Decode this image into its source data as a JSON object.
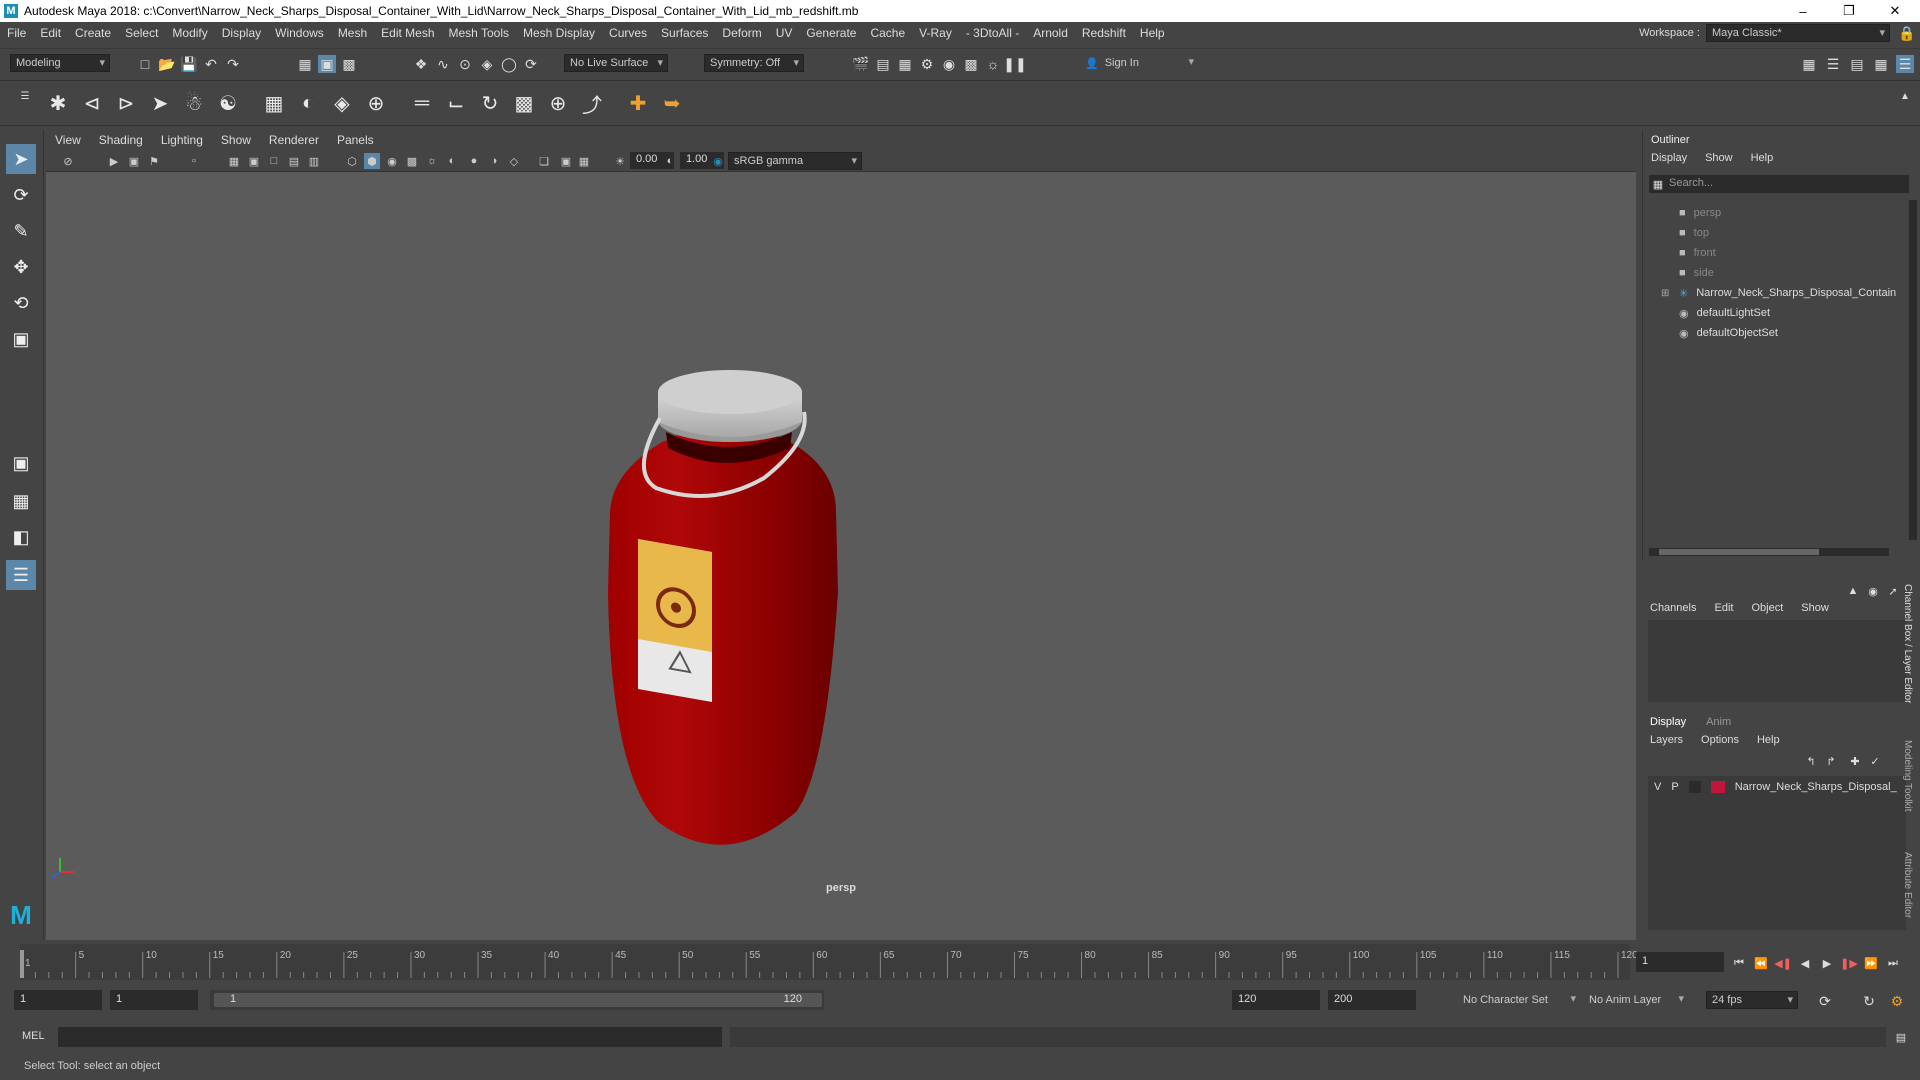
{
  "window": {
    "title": "Autodesk Maya 2018: c:\\Convert\\Narrow_Neck_Sharps_Disposal_Container_With_Lid\\Narrow_Neck_Sharps_Disposal_Container_With_Lid_mb_redshift.mb",
    "logo_letter": "M",
    "minimize": "–",
    "restore": "❐",
    "close": "✕"
  },
  "menubar": {
    "items": [
      "File",
      "Edit",
      "Create",
      "Select",
      "Modify",
      "Display",
      "Windows",
      "Mesh",
      "Edit Mesh",
      "Mesh Tools",
      "Mesh Display",
      "Curves",
      "Surfaces",
      "Deform",
      "UV",
      "Generate",
      "Cache",
      "V-Ray",
      "- 3DtoAll -",
      "Arnold",
      "Redshift",
      "Help"
    ],
    "workspace_label": "Workspace :",
    "workspace_value": "Maya Classic*"
  },
  "statusline": {
    "mode": "Modeling",
    "live_surface": "No Live Surface",
    "symmetry": "Symmetry: Off",
    "sign_in": "Sign In"
  },
  "viewport": {
    "menus": [
      "View",
      "Shading",
      "Lighting",
      "Show",
      "Renderer",
      "Panels"
    ],
    "exposure": "0.00",
    "gamma": "1.00",
    "color_space": "sRGB gamma",
    "camera": "persp"
  },
  "outliner": {
    "title": "Outliner",
    "menus": [
      "Display",
      "Show",
      "Help"
    ],
    "search_placeholder": "Search...",
    "items": [
      {
        "label": "persp",
        "dim": true
      },
      {
        "label": "top",
        "dim": true
      },
      {
        "label": "front",
        "dim": true
      },
      {
        "label": "side",
        "dim": true
      },
      {
        "label": "Narrow_Neck_Sharps_Disposal_Contain",
        "dim": false
      },
      {
        "label": "defaultLightSet",
        "dim": false
      },
      {
        "label": "defaultObjectSet",
        "dim": false
      }
    ]
  },
  "channel_box": {
    "menus": [
      "Channels",
      "Edit",
      "Object",
      "Show"
    ],
    "side_label": "Channel Box / Layer Editor"
  },
  "layer_editor": {
    "tabs": [
      "Display",
      "Anim"
    ],
    "menus": [
      "Layers",
      "Options",
      "Help"
    ],
    "layer": {
      "v": "V",
      "p": "P",
      "name": "Narrow_Neck_Sharps_Disposal_",
      "color": "#c0163c"
    }
  },
  "side_tabs": [
    "Modeling Toolkit",
    "Attribute Editor"
  ],
  "timeline": {
    "ticks": [
      "1",
      "5",
      "10",
      "15",
      "20",
      "25",
      "30",
      "35",
      "40",
      "45",
      "50",
      "55",
      "60",
      "65",
      "70",
      "75",
      "80",
      "85",
      "90",
      "95",
      "100",
      "105",
      "110",
      "115",
      "120"
    ],
    "current_frame": "1"
  },
  "range": {
    "start": "1",
    "playback_start": "1",
    "slider_start": "1",
    "slider_end": "120",
    "playback_end": "120",
    "end": "200",
    "character_set": "No Character Set",
    "anim_layer": "No Anim Layer",
    "fps": "24 fps"
  },
  "command": {
    "label": "MEL"
  },
  "help_line": "Select Tool: select an object",
  "colors": {
    "container_red": "#8b0000",
    "lid_gray": "#c8c8c8",
    "label_yellow": "#e8b84a",
    "active_tool": "#5d87a8"
  }
}
